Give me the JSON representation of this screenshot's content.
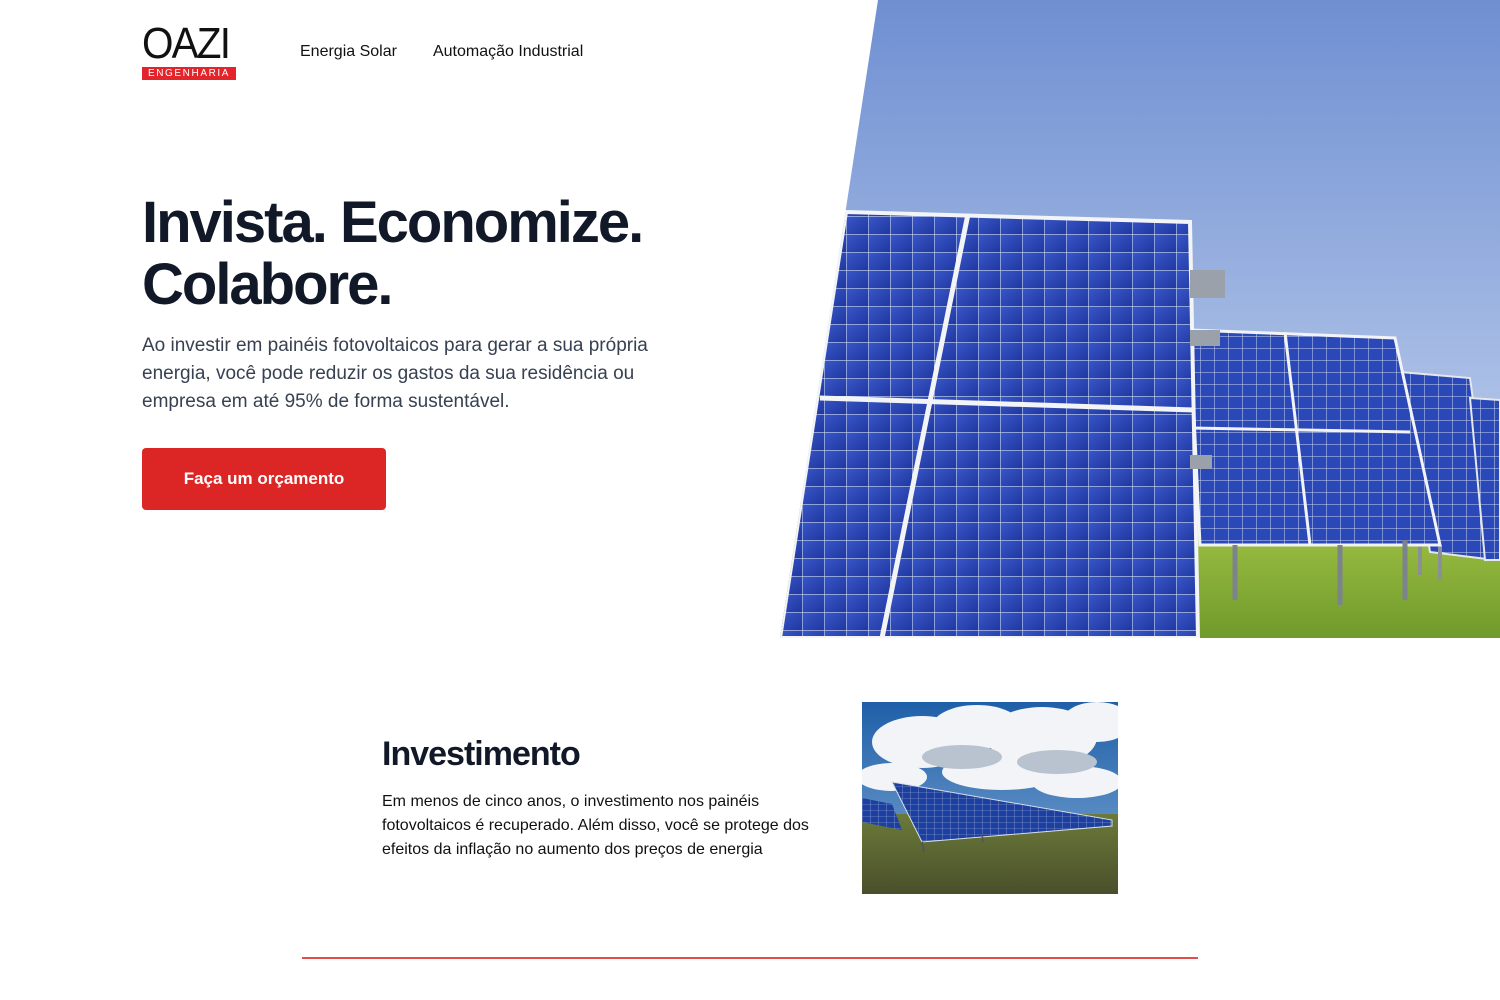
{
  "brand": {
    "logo_word": "OAZI",
    "logo_tag": "ENGENHARIA",
    "accent_color": "#e3242b"
  },
  "nav": {
    "items": [
      {
        "label": "Energia Solar"
      },
      {
        "label": "Automação Industrial"
      }
    ]
  },
  "hero": {
    "title_line1": "Invista. Economize.",
    "title_line2": "Colabore.",
    "subtitle": "Ao investir em painéis fotovoltaicos para gerar a sua própria energia, você pode reduzir os gastos da sua residência ou empresa em até 95% de forma sustentável.",
    "cta_label": "Faça um orçamento",
    "cta_color": "#dc2626"
  },
  "feature": {
    "title": "Investimento",
    "text": "Em menos de cinco anos, o investimento nos painéis fotovoltaicos é recuperado. Além disso, você se protege dos efeitos da inflação no aumento dos preços de energia"
  }
}
